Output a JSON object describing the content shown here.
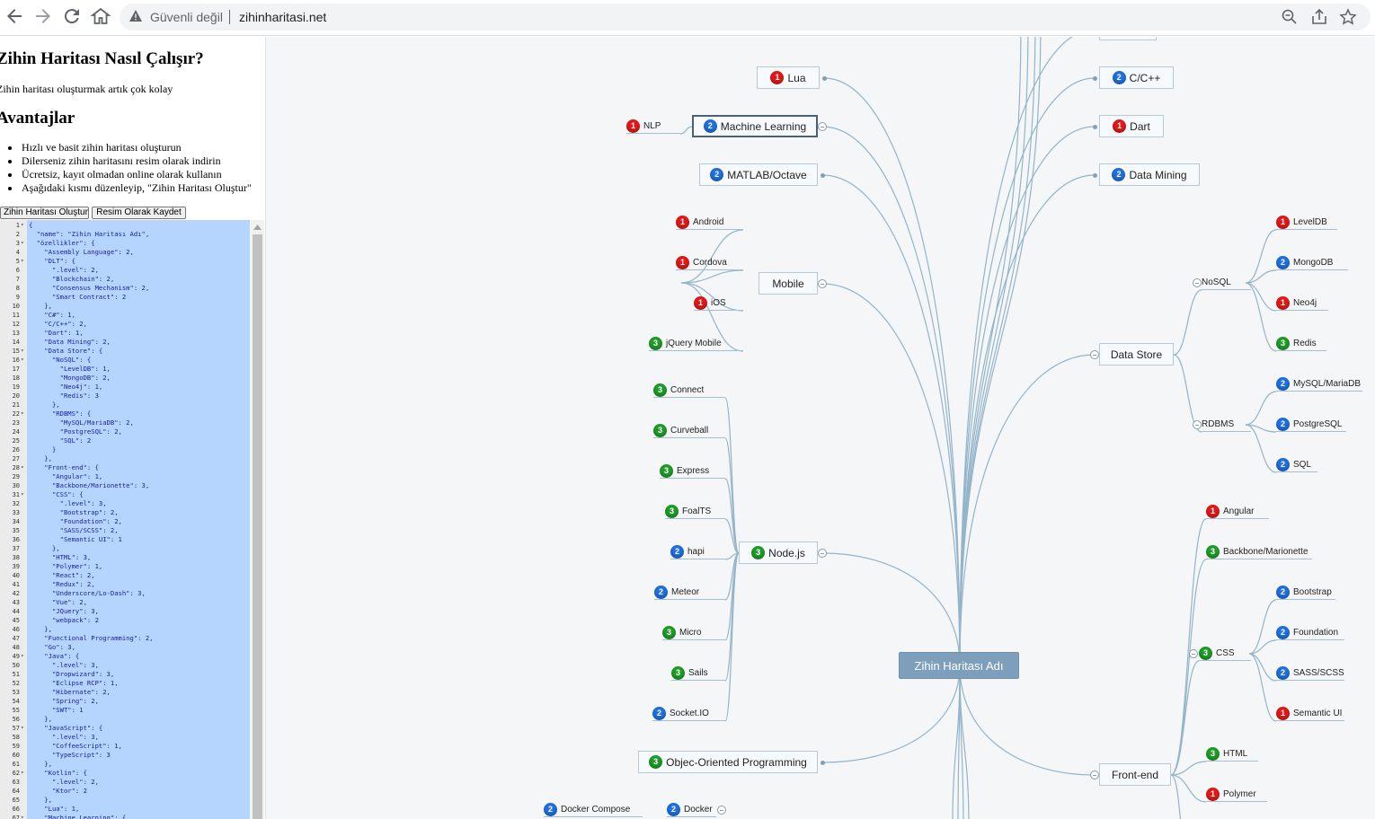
{
  "browser": {
    "security_text": "Güvenli değil",
    "url": "zihinharitasi.net"
  },
  "panel": {
    "title": "Zihin Haritası Nasıl Çalışır?",
    "intro": "Zihin haritası oluşturmak artık çok kolay",
    "advantages_title": "Avantajlar",
    "advantages": [
      "Hızlı ve basit zihin haritası oluşturun",
      "Dilerseniz zihin haritasını resim olarak indirin",
      "Ücretsiz, kayıt olmadan online olarak kullanın",
      "Aşağıdaki kısmı düzenleyip, \"Zihin Haritası Oluştur\""
    ],
    "create_button": "Zihin Haritası Oluştur",
    "save_button": "Resim Olarak Kaydet"
  },
  "editor_lines": [
    "{",
    "  \"name\": \"Zihin Haritası Adı\",",
    "  \"özellikler\": {",
    "    \"Assembly Language\": 2,",
    "    \"DLT\": {",
    "      \".level\": 2,",
    "      \"Blockchain\": 2,",
    "      \"Consensus Mechanism\": 2,",
    "      \"Smart Contract\": 2",
    "    },",
    "    \"C#\": 1,",
    "    \"C/C++\": 2,",
    "    \"Dart\": 1,",
    "    \"Data Mining\": 2,",
    "    \"Data Store\": {",
    "      \"NoSQL\": {",
    "        \"LevelDB\": 1,",
    "        \"MongoDB\": 2,",
    "        \"Neo4j\": 1,",
    "        \"Redis\": 3",
    "      },",
    "      \"RDBMS\": {",
    "        \"MySQL/MariaDB\": 2,",
    "        \"PostgreSQL\": 2,",
    "        \"SQL\": 2",
    "      }",
    "    },",
    "    \"Front-end\": {",
    "      \"Angular\": 1,",
    "      \"Backbone/Marionette\": 3,",
    "      \"CSS\": {",
    "        \".level\": 3,",
    "        \"Bootstrap\": 2,",
    "        \"Foundation\": 2,",
    "        \"SASS/SCSS\": 2,",
    "        \"Semantic UI\": 1",
    "      },",
    "      \"HTML\": 3,",
    "      \"Polymer\": 1,",
    "      \"React\": 2,",
    "      \"Redux\": 2,",
    "      \"Underscore/Lo-Dash\": 3,",
    "      \"Vue\": 2,",
    "      \"JQuery\": 3,",
    "      \"webpack\": 2",
    "    },",
    "    \"Functional Programming\": 2,",
    "    \"Go\": 3,",
    "    \"Java\": {",
    "      \".level\": 3,",
    "      \"Dropwizard\": 3,",
    "      \"Eclipse RCP\": 1,",
    "      \"Hibernate\": 2,",
    "      \"Spring\": 2,",
    "      \"SWT\": 1",
    "    },",
    "    \"JavaScript\": {",
    "      \".level\": 3,",
    "      \"CoffeeScript\": 1,",
    "      \"TypeScript\": 3",
    "    },",
    "    \"Kotlin\": {",
    "      \".level\": 2,",
    "      \"Ktor\": 2",
    "    },",
    "    \"Lua\": 1,",
    "    \"Machine Learning\": {"
  ],
  "fold_lines": [
    1,
    3,
    5,
    15,
    16,
    22,
    28,
    31,
    49,
    57,
    62,
    67
  ],
  "map": {
    "root": "Zihin Haritası Adı",
    "topics": [
      {
        "label": "Lua",
        "level": "1"
      },
      {
        "label": "Machine Learning",
        "level": "2"
      },
      {
        "label": "MATLAB/Octave",
        "level": "2"
      },
      {
        "label": "Mobile",
        "level": ""
      },
      {
        "label": "Node.js",
        "level": "3"
      },
      {
        "label": "Objec-Oriented Programming",
        "level": "3"
      },
      {
        "label": "C/C++",
        "level": "2"
      },
      {
        "label": "Dart",
        "level": "1"
      },
      {
        "label": "Data Mining",
        "level": "2"
      },
      {
        "label": "Data Store",
        "level": ""
      },
      {
        "label": "Front-end",
        "level": ""
      }
    ],
    "leaves": [
      {
        "label": "NLP",
        "level": "1"
      },
      {
        "label": "Android",
        "level": "1"
      },
      {
        "label": "Cordova",
        "level": "1"
      },
      {
        "label": "iOS",
        "level": "1"
      },
      {
        "label": "jQuery Mobile",
        "level": "3"
      },
      {
        "label": "Connect",
        "level": "3"
      },
      {
        "label": "Curveball",
        "level": "3"
      },
      {
        "label": "Express",
        "level": "3"
      },
      {
        "label": "FoalTS",
        "level": "3"
      },
      {
        "label": "hapi",
        "level": "2"
      },
      {
        "label": "Meteor",
        "level": "2"
      },
      {
        "label": "Micro",
        "level": "3"
      },
      {
        "label": "Sails",
        "level": "3"
      },
      {
        "label": "Socket.IO",
        "level": "2"
      },
      {
        "label": "Docker Compose",
        "level": "2"
      },
      {
        "label": "Docker",
        "level": "2"
      },
      {
        "label": "NoSQL",
        "level": ""
      },
      {
        "label": "LevelDB",
        "level": "1"
      },
      {
        "label": "MongoDB",
        "level": "2"
      },
      {
        "label": "Neo4j",
        "level": "1"
      },
      {
        "label": "Redis",
        "level": "3"
      },
      {
        "label": "RDBMS",
        "level": ""
      },
      {
        "label": "MySQL/MariaDB",
        "level": "2"
      },
      {
        "label": "PostgreSQL",
        "level": "2"
      },
      {
        "label": "SQL",
        "level": "2"
      },
      {
        "label": "Angular",
        "level": "1"
      },
      {
        "label": "Backbone/Marionette",
        "level": "3"
      },
      {
        "label": "CSS",
        "level": "3"
      },
      {
        "label": "Bootstrap",
        "level": "2"
      },
      {
        "label": "Foundation",
        "level": "2"
      },
      {
        "label": "SASS/SCSS",
        "level": "2"
      },
      {
        "label": "Semantic UI",
        "level": "1"
      },
      {
        "label": "HTML",
        "level": "3"
      },
      {
        "label": "Polymer",
        "level": "1"
      }
    ]
  },
  "colors": {
    "level1": "#e21818",
    "level2": "#1f6fde",
    "level3": "#1f9b28",
    "root": "#7d9fbb",
    "link": "#94b4c9"
  }
}
